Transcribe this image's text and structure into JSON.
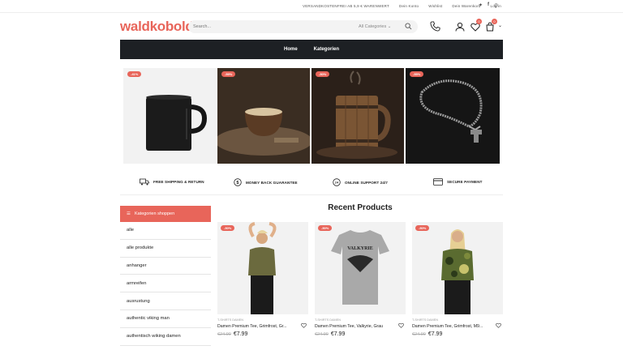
{
  "topbar": {
    "shipping_notice": "VERSANDKOSTENFREI AB 5,9 € WARENWERT",
    "links": [
      "Dein Konto",
      "Wishlist",
      "Dein Warenkorb",
      "Log in"
    ]
  },
  "header": {
    "logo": "waldkobold",
    "search_placeholder": "Search...",
    "category_select": "All Categories",
    "wishlist_count": "0",
    "cart_count": "0"
  },
  "nav": {
    "items": [
      "Home",
      "Kategorien"
    ]
  },
  "banners": [
    {
      "badge": "-41%",
      "icon": "black-mug-image"
    },
    {
      "badge": "-59%",
      "icon": "coconut-cup-image"
    },
    {
      "badge": "-50%",
      "icon": "wooden-tankard-image"
    },
    {
      "badge": "-55%",
      "icon": "thor-hammer-necklace-image"
    }
  ],
  "features": [
    {
      "label": "FREE SHIPPING & RETURN",
      "icon": "truck-icon"
    },
    {
      "label": "MONEY BACK GUARANTEE",
      "icon": "dollar-icon"
    },
    {
      "label": "ONLINE SUPPORT 24/7",
      "icon": "support-icon"
    },
    {
      "label": "SECURE PAYMENT",
      "icon": "card-icon"
    }
  ],
  "sidebar": {
    "title": "Kategorien shoppen",
    "items": [
      "alle",
      "alle produkte",
      "anhanger",
      "armreifen",
      "ausrustung",
      "authentic viking man",
      "authentisch wiking damen"
    ]
  },
  "recent": {
    "title": "Recent Products",
    "products": [
      {
        "badge": "-50%",
        "category": "T-SHIRTS DAMEN",
        "name": "Damen Premium Tee, Grimfrost, Gr...",
        "old_price": "€24.90",
        "price": "€7.99",
        "image": "olive-tee-woman"
      },
      {
        "badge": "-50%",
        "category": "T-SHIRTS DAMEN",
        "name": "Damen Premium Tee, Valkyrie, Grau",
        "old_price": "€24.90",
        "price": "€7.99",
        "image": "grey-valkyrie-tee"
      },
      {
        "badge": "-50%",
        "category": "T-SHIRTS DAMEN",
        "name": "Damen Premium Tee, Grimfrost, M9...",
        "old_price": "€24.90",
        "price": "€7.99",
        "image": "camo-tee-woman"
      }
    ]
  },
  "colors": {
    "accent": "#e8655a",
    "nav_bg": "#1d2024"
  }
}
